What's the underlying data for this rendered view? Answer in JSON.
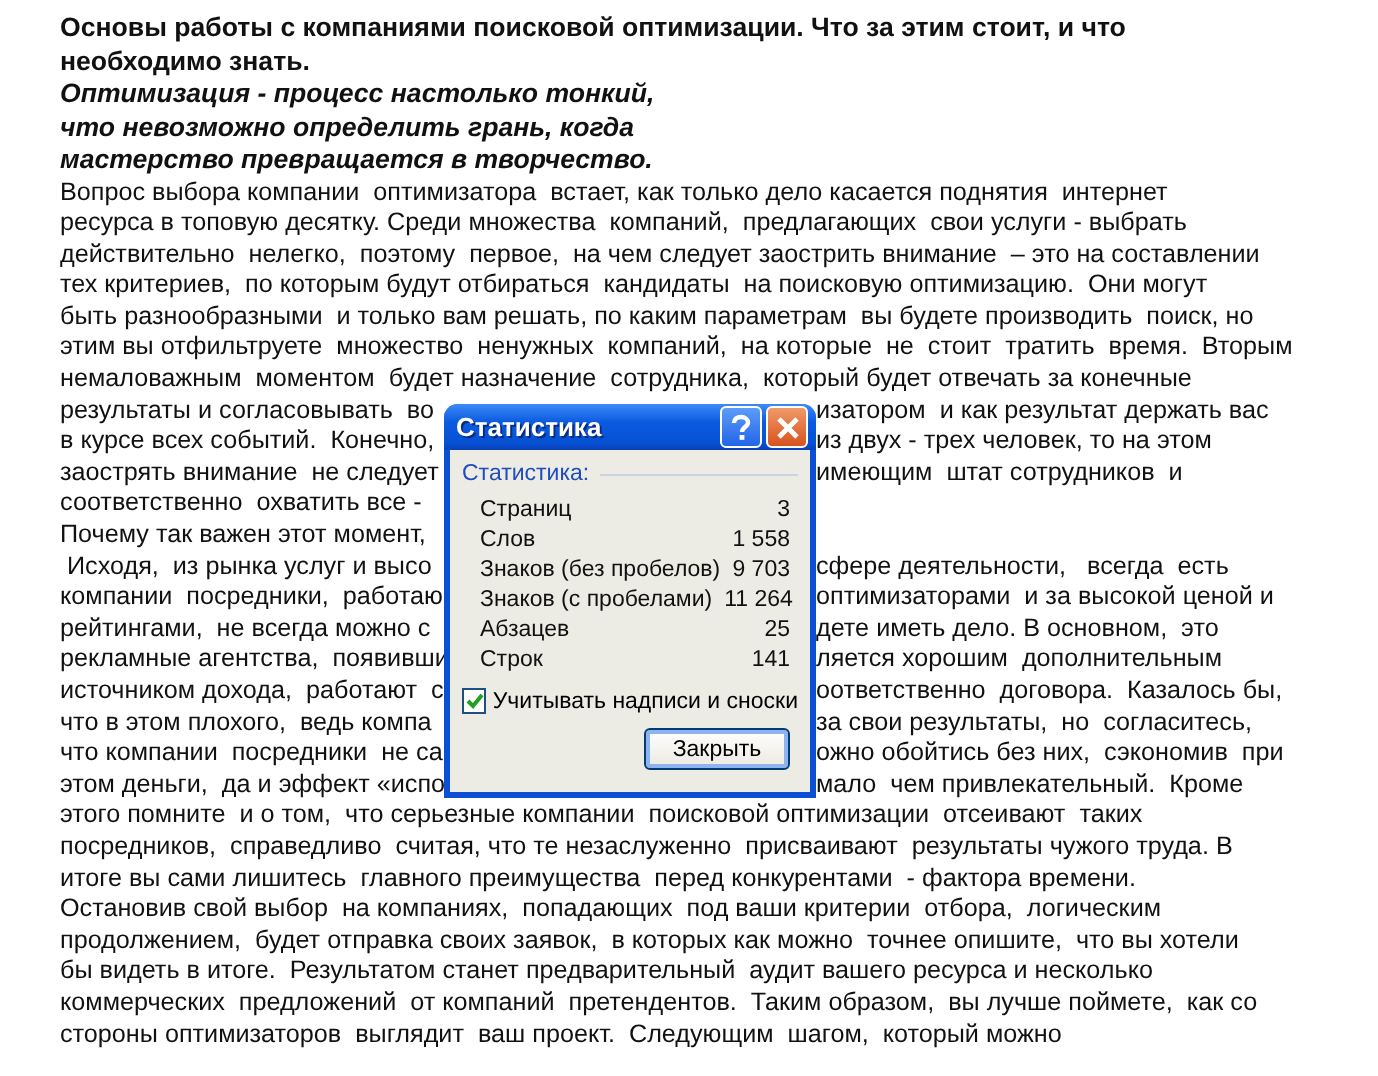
{
  "document": {
    "lines": [
      {
        "kind": "heading",
        "text": "Основы работы с компаниями поисковой оптимизации. Что за этим стоит, и что"
      },
      {
        "kind": "heading",
        "text": "необходимо знать."
      },
      {
        "kind": "epigraph",
        "text": "Оптимизация - процесс настолько тонкий,"
      },
      {
        "kind": "epigraph",
        "text": "что невозможно определить грань, когда"
      },
      {
        "kind": "epigraph",
        "text": "мастерство превращается в творчество."
      },
      {
        "kind": "body",
        "text": "Вопрос выбора компании  оптимизатора  встает, как только дело касается поднятия  интернет"
      },
      {
        "kind": "body",
        "text": "ресурса в топовую десятку. Среди множества  компаний,  предлагающих  свои услуги - выбрать"
      },
      {
        "kind": "body",
        "text": "действительно  нелегко,  поэтому  первое,  на чем следует заострить внимание  – это на составлении"
      },
      {
        "kind": "body",
        "text": "тех критериев,  по которым будут отбираться  кандидаты  на поисковую оптимизацию.  Они могут"
      },
      {
        "kind": "body",
        "text": "быть разнообразными  и только вам решать, по каким параметрам  вы будете производить  поиск, но"
      },
      {
        "kind": "body",
        "text": "этим вы отфильтруете  множество  ненужных  компаний,  на которые  не  стоит  тратить  время.  Вторым"
      },
      {
        "kind": "body",
        "text": "немаловажным  моментом  будет назначение  сотрудника,  который будет отвечать за конечные"
      },
      {
        "kind": "body",
        "left": "результаты и согласовывать  во",
        "right": "изатором  и как результат держать вас"
      },
      {
        "kind": "body",
        "left": "в курсе всех событий.  Конечно,",
        "right": "из двух - трех человек, то на этом"
      },
      {
        "kind": "body",
        "left": "заострять внимание  не следует",
        "right": "имеющим  штат сотрудников  и"
      },
      {
        "kind": "body",
        "left": "соответственно  охватить все -"
      },
      {
        "kind": "body",
        "left": "Почему так важен этот момент,"
      },
      {
        "kind": "body",
        "left": " Исходя,  из рынка услуг и высо",
        "right": "сфере деятельности,   всегда  есть"
      },
      {
        "kind": "body",
        "left": "компании  посредники,  работаю",
        "right": "оптимизаторами  и за высокой ценой и"
      },
      {
        "kind": "body",
        "left": "рейтингами,  не всегда можно с",
        "right": "дете иметь дело. В основном,  это"
      },
      {
        "kind": "body",
        "left": "рекламные агентства,  появивши",
        "right": "ляется хорошим  дополнительным"
      },
      {
        "kind": "body",
        "left": "источником дохода,  работают  с",
        "right": "оответственно  договора.  Казалось бы,"
      },
      {
        "kind": "body",
        "left": "что в этом плохого,  ведь компа",
        "right": "за свои результаты,  но  согласитесь,"
      },
      {
        "kind": "body",
        "left": "что компании  посредники  не са",
        "right": "ожно обойтись без них,  сэкономив  при"
      },
      {
        "kind": "body",
        "left": "этом деньги,  да и эффект «испо",
        "right": "мало  чем привлекательный.  Кроме"
      },
      {
        "kind": "body",
        "text": "этого помните  и о том,  что серьезные компании  поисковой оптимизации  отсеивают  таких"
      },
      {
        "kind": "body",
        "text": "посредников,  справедливо  считая, что те незаслуженно  присваивают  результаты чужого труда. В"
      },
      {
        "kind": "body",
        "text": "итоге вы сами лишитесь  главного преимущества  перед конкурентами  - фактора времени."
      },
      {
        "kind": "body",
        "text": "Остановив свой выбор  на компаниях,  попадающих  под ваши критерии  отбора,  логическим"
      },
      {
        "kind": "body",
        "text": "продолжением,  будет отправка своих заявок,  в которых как можно  точнее опишите,  что вы хотели"
      },
      {
        "kind": "body",
        "text": "бы видеть в итоге.  Результатом станет предварительный  аудит вашего ресурса и несколько"
      },
      {
        "kind": "body",
        "text": "коммерческих  предложений  от компаний  претендентов.  Таким образом,  вы лучше поймете,  как со"
      },
      {
        "kind": "body",
        "text": "стороны оптимизаторов  выглядит  ваш проект.  Следующим  шагом,  который можно"
      }
    ]
  },
  "dialog": {
    "title": "Статистика",
    "group_label": "Статистика:",
    "stats": [
      {
        "label": "Страниц",
        "value": "3"
      },
      {
        "label": "Слов",
        "value": "1 558"
      },
      {
        "label": "Знаков (без пробелов)",
        "value": "9 703"
      },
      {
        "label": "Знаков (с пробелами)",
        "value": "11 264"
      },
      {
        "label": "Абзацев",
        "value": "25"
      },
      {
        "label": "Строк",
        "value": "141"
      }
    ],
    "include_textboxes": {
      "label": "Учитывать надписи и сноски",
      "checked": true
    },
    "button": "Закрыть"
  }
}
